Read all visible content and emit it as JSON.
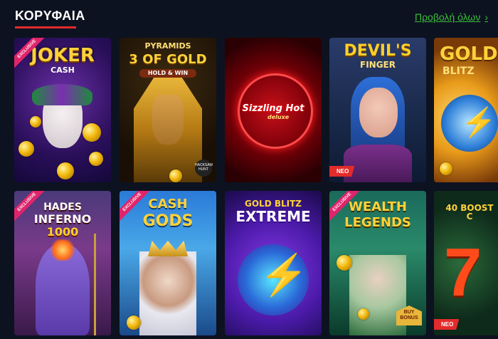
{
  "section": {
    "title": "ΚΟΡΥΦΑΙΑ",
    "view_all": "Προβολή όλων",
    "view_all_icon": "chevron-right-icon"
  },
  "colors": {
    "background": "#0d1220",
    "accent_underline": "#e32b2b",
    "link": "#3bbf3b",
    "new_badge": "#e32b2b",
    "exclusive_badge": "#e0246b"
  },
  "games": [
    {
      "title": "JOKER",
      "subtitle": "CASH",
      "badge": "EXCLUSIVE",
      "row": 1
    },
    {
      "title": "PYRAMIDS",
      "subtitle": "3 OF GOLD",
      "tagline": "HOLD & WIN",
      "corner": "HACKSAW HUNT",
      "row": 1
    },
    {
      "title": "Sizzling Hot",
      "subtitle": "deluxe",
      "row": 1
    },
    {
      "title": "DEVIL'S",
      "subtitle": "FINGER",
      "badge": "NEO",
      "row": 1
    },
    {
      "title": "GOLD",
      "subtitle": "BLITZ",
      "row": 1
    },
    {
      "title": "HADES",
      "subtitle": "INFERNO",
      "tagline": "1000",
      "badge": "EXCLUSIVE",
      "row": 2
    },
    {
      "title": "CASH",
      "subtitle": "GODS",
      "badge": "EXCLUSIVE",
      "row": 2
    },
    {
      "title": "GOLD BLITZ",
      "subtitle": "EXTREME",
      "row": 2
    },
    {
      "title": "WEALTH",
      "subtitle": "LEGENDS",
      "tagline": "BUY BONUS",
      "badge": "EXCLUSIVE",
      "row": 2
    },
    {
      "title": "40 BOOST C",
      "badge": "NEO",
      "row": 2
    }
  ]
}
